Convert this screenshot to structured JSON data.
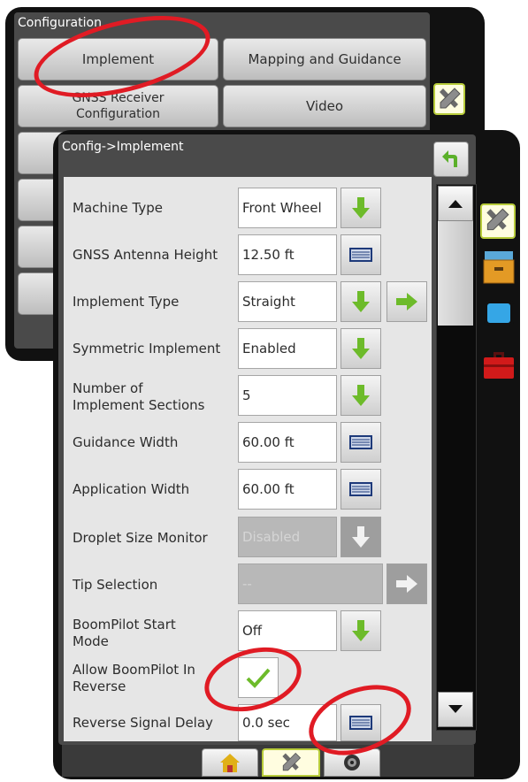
{
  "config_window": {
    "title": "Configuration",
    "buttons": [
      "Implement",
      "Mapping and Guidance",
      "GNSS Receiver Configuration",
      "Video"
    ]
  },
  "implement_window": {
    "title": "Config->Implement",
    "rows": [
      {
        "label": "Machine Type",
        "value": "Front Wheel"
      },
      {
        "label": "GNSS Antenna Height",
        "value": "12.50 ft"
      },
      {
        "label": "Implement Type",
        "value": "Straight"
      },
      {
        "label": "Symmetric Implement",
        "value": "Enabled"
      },
      {
        "label": "Number of Implement Sections",
        "value": "5"
      },
      {
        "label": "Guidance Width",
        "value": "60.00 ft"
      },
      {
        "label": "Application Width",
        "value": "60.00 ft"
      },
      {
        "label": "Droplet Size Monitor",
        "value": "Disabled"
      },
      {
        "label": "Tip Selection",
        "value": "--"
      },
      {
        "label": "BoomPilot Start Mode",
        "value": "Off"
      },
      {
        "label": "Allow BoomPilot In Reverse",
        "value": "checked"
      },
      {
        "label": "Reverse Signal Delay",
        "value": "0.0 sec"
      }
    ]
  },
  "sidebar_icons": [
    "tools-icon",
    "drawer-icon",
    "display-icon",
    "toolbox-icon"
  ],
  "bottom_tabs": [
    "home-icon",
    "tools-icon",
    "camera-icon"
  ],
  "colors": {
    "accent": "#b8cc3a",
    "highlight": "#e01b24",
    "arrow_green": "#6dbb2a"
  }
}
